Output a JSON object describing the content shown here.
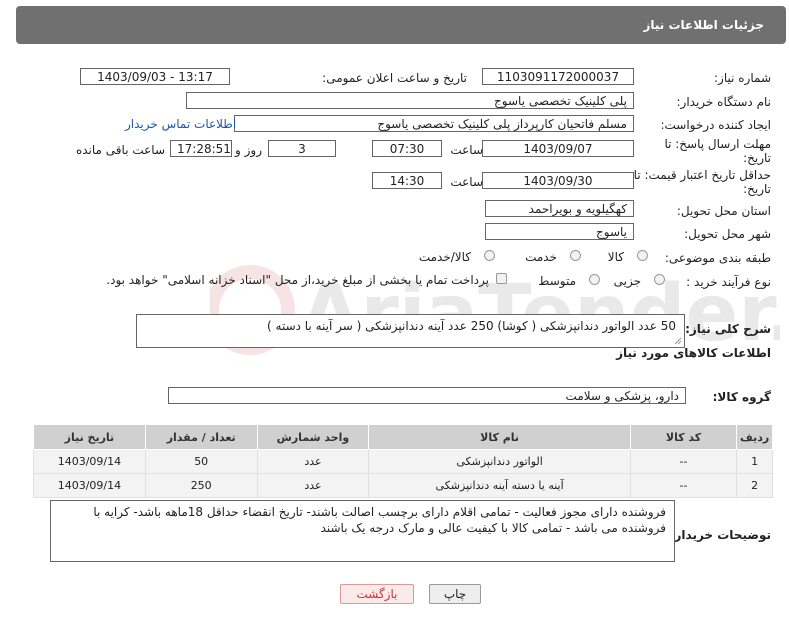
{
  "header": {
    "title": "جزئیات اطلاعات نیاز"
  },
  "watermark": {
    "text": "AriaTender.net"
  },
  "labels": {
    "need_number": "شماره نیاز:",
    "announce_datetime": "تاریخ و ساعت اعلان عمومی:",
    "buyer_org": "نام دستگاه خریدار:",
    "requester": "ایجاد کننده درخواست:",
    "send_deadline": "مهلت ارسال پاسخ: تا تاریخ:",
    "time": "ساعت",
    "days_and": "روز و",
    "remaining": "ساعت باقی مانده",
    "price_validity": "حداقل تاریخ اعتبار قیمت: تا تاریخ:",
    "province": "استان محل تحویل:",
    "city": "شهر محل تحویل:",
    "category": "طبقه بندی موضوعی:",
    "purchase_type": "نوع فرآیند خرید :",
    "need_desc": "شرح کلی نیاز:",
    "goods_info": "اطلاعات کالاهای مورد نیاز",
    "goods_group": "گروه کالا:",
    "buyer_notes": "توضیحات خریدار:"
  },
  "values": {
    "need_number": "1103091172000037",
    "announce_datetime": "1403/09/03 - 13:17",
    "buyer_org": "پلی کلینیک تخصصی یاسوج",
    "requester": "مسلم فاتحیان کارپرداز  پلی کلینیک تخصصی یاسوج",
    "contact_link": "اطلاعات تماس خریدار",
    "send_date": "1403/09/07",
    "send_time": "07:30",
    "days": "3",
    "remaining_time": "17:28:51",
    "validity_date": "1403/09/30",
    "validity_time": "14:30",
    "province": "کهگیلویه و بویراحمد",
    "city": "یاسوج",
    "goods_group": "دارو، پزشکی و سلامت"
  },
  "category_options": [
    "کالا",
    "خدمت",
    "کالا/خدمت"
  ],
  "purchase_options": [
    "جزیی",
    "متوسط"
  ],
  "payment_note": "پرداخت تمام یا بخشی از مبلغ خرید،از محل \"اسناد خزانه اسلامی\" خواهد بود.",
  "need_desc": "50  عدد  الواتور دندانپزشکی ( کوشا) 250 عدد آینه دندانپزشکی ( سر آینه با دسته )",
  "table": {
    "headers": [
      "ردیف",
      "کد کالا",
      "نام کالا",
      "واحد شمارش",
      "تعداد / مقدار",
      "تاریخ نیاز"
    ],
    "rows": [
      [
        "1",
        "--",
        "الواتور دندانپزشکی",
        "عدد",
        "50",
        "1403/09/14"
      ],
      [
        "2",
        "--",
        "آینه یا دسته آینه دندانپزشکی",
        "عدد",
        "250",
        "1403/09/14"
      ]
    ]
  },
  "buyer_notes": "فروشنده دارای مجوز فعالیت - تمامی اقلام دارای برچسب اصالت باشند- تاریخ انقضاء حداقل 18ماهه باشد- کرایه با فروشنده می باشد -  تمامی کالا با کیفیت عالی و مارک درجه یک باشند",
  "buttons": {
    "print": "چاپ",
    "back": "بازگشت"
  }
}
